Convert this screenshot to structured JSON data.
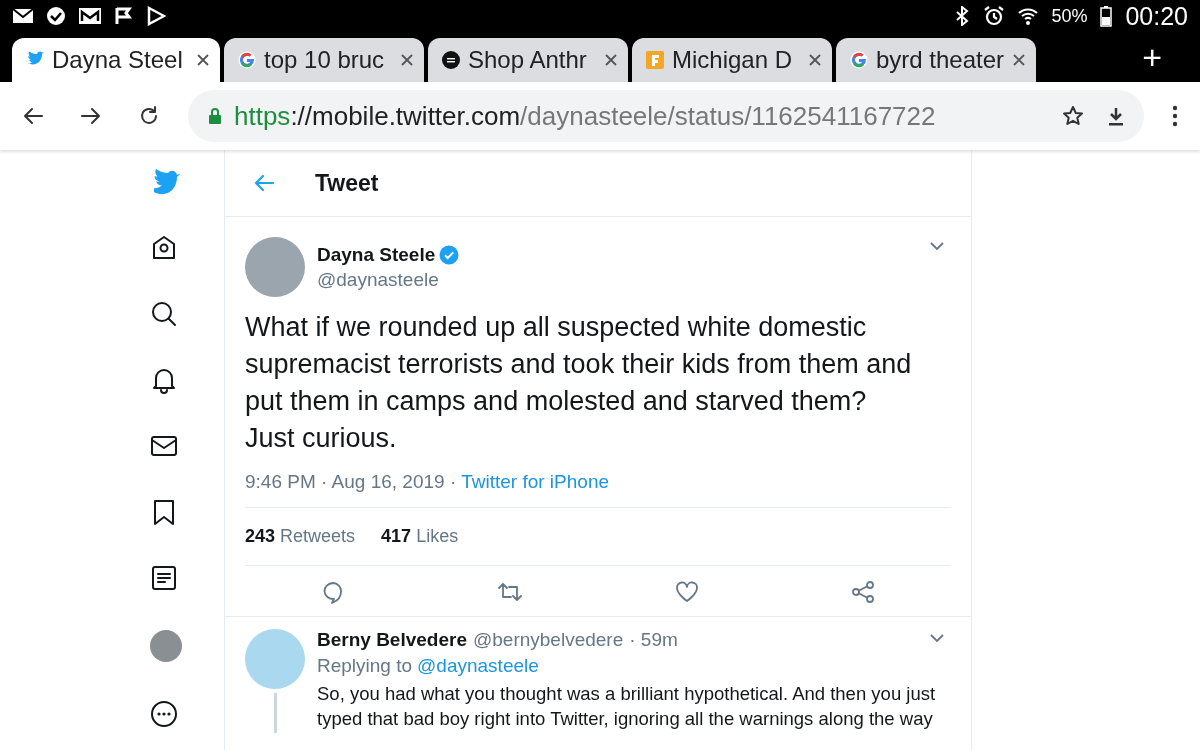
{
  "status_bar": {
    "battery": "50%",
    "time": "00:20"
  },
  "tabs": [
    {
      "title": "Dayna Steel",
      "kind": "bird",
      "selected": true
    },
    {
      "title": "top 10 bruc",
      "kind": "google",
      "selected": false
    },
    {
      "title": "Shop Anthr",
      "kind": "food",
      "selected": false
    },
    {
      "title": "Michigan D",
      "kind": "square",
      "selected": false
    },
    {
      "title": "byrd theater",
      "kind": "google",
      "selected": false
    }
  ],
  "new_tab": "+",
  "address_bar": {
    "scheme": "https",
    "host": "://mobile.twitter.com",
    "path": "/daynasteele/status/1162541167722"
  },
  "header": {
    "title": "Tweet"
  },
  "tweet": {
    "name": "Dayna Steele",
    "verified": true,
    "handle": "@daynasteele",
    "text": "What if we rounded up all suspected white domestic supremacist terrorists and took their kids from them and put them in camps and molested and starved them? Just curious.",
    "time": "9:46 PM · Aug 16, 2019 · ",
    "source": "Twitter for iPhone",
    "stats": [
      {
        "count": "243",
        "label": "Retweets"
      },
      {
        "count": "417",
        "label": "Likes"
      }
    ]
  },
  "reply": {
    "name": "Berny Belvedere",
    "handle": "@bernybelvedere",
    "age": "· 59m",
    "replying_to": "Replying to",
    "mention": "@daynasteele",
    "text": "So, you had what you thought was a brilliant hypothetical. And then you just typed that bad boy right into Twitter, ignoring all the warnings along the way"
  }
}
